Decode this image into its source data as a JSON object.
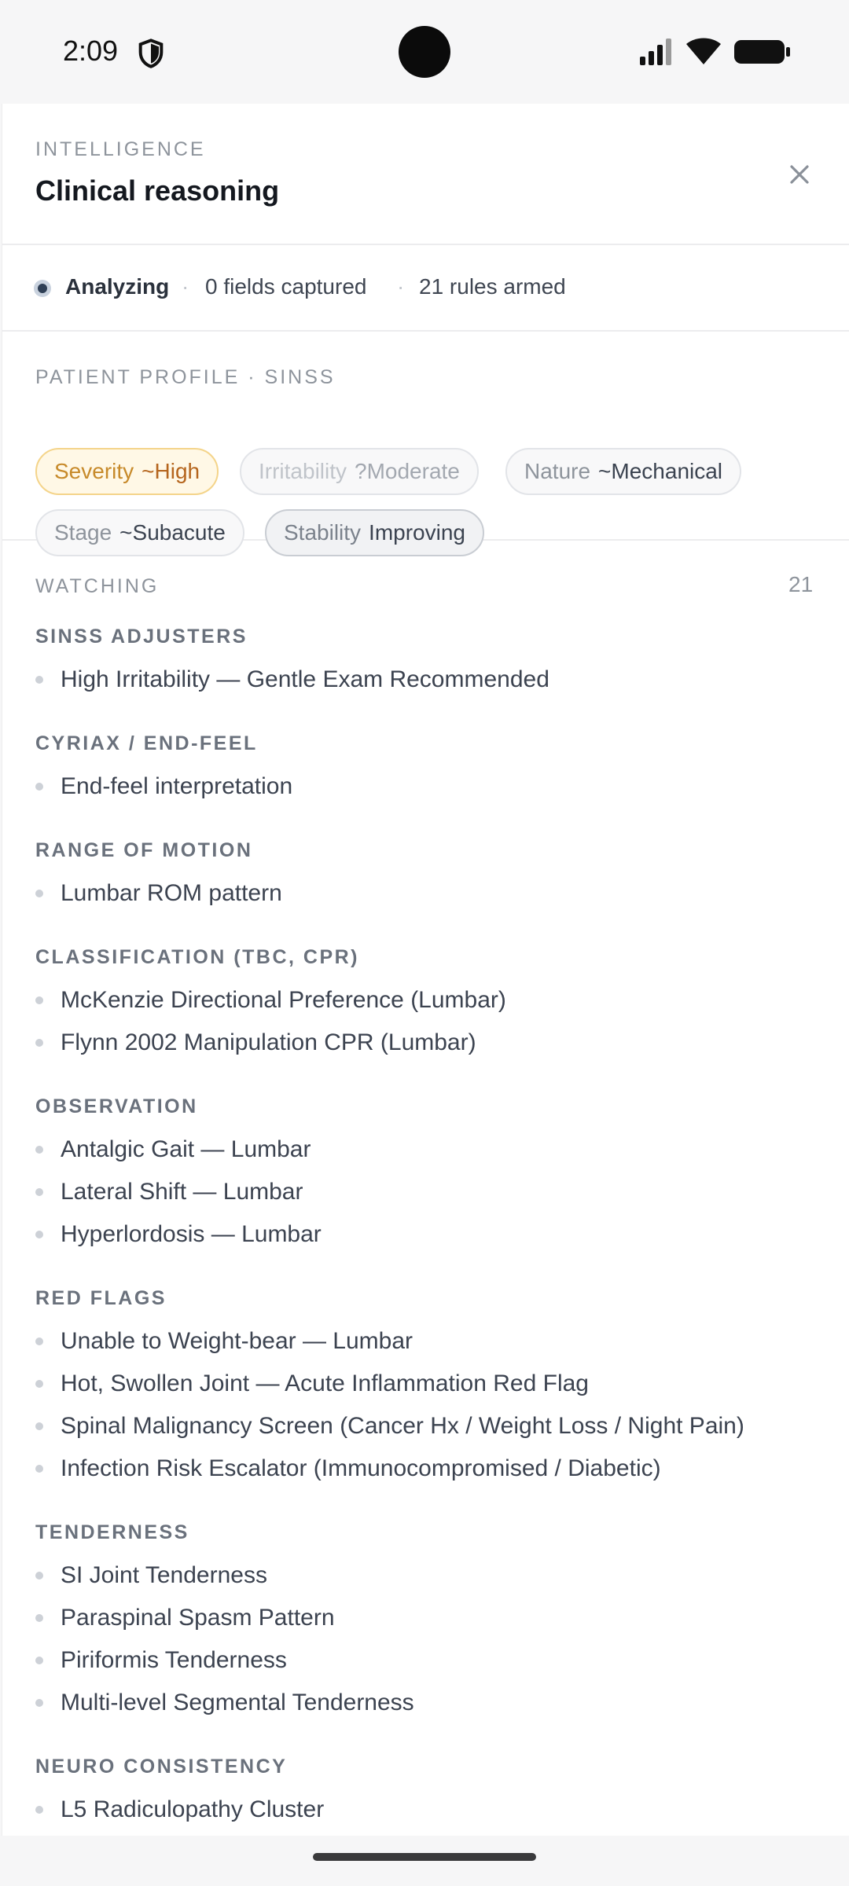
{
  "status_bar": {
    "time": "2:09",
    "icons": [
      "shield-icon",
      "signal-icon",
      "wifi-icon",
      "battery-icon"
    ]
  },
  "header": {
    "eyebrow": "INTELLIGENCE",
    "title": "Clinical reasoning",
    "close_icon": "×"
  },
  "status": {
    "state": "Analyzing",
    "sep": "·",
    "fields": "0 fields captured",
    "rules": "21 rules armed"
  },
  "profile": {
    "label": "PATIENT PROFILE · SINSS",
    "chips": [
      {
        "key": "Severity",
        "value": "~High"
      },
      {
        "key": "Irritability",
        "value": "?Moderate"
      },
      {
        "key": "Nature",
        "value": "~Mechanical"
      },
      {
        "key": "Stage",
        "value": "~Subacute"
      },
      {
        "key": "Stability",
        "value": "Improving"
      }
    ]
  },
  "watching": {
    "label": "WATCHING",
    "count": "21",
    "groups": [
      {
        "title": "SINSS ADJUSTERS",
        "items": [
          "High Irritability — Gentle Exam Recommended"
        ]
      },
      {
        "title": "CYRIAX / END-FEEL",
        "items": [
          "End-feel interpretation"
        ]
      },
      {
        "title": "RANGE OF MOTION",
        "items": [
          "Lumbar ROM pattern"
        ]
      },
      {
        "title": "CLASSIFICATION (TBC, CPR)",
        "items": [
          "McKenzie Directional Preference (Lumbar)",
          "Flynn 2002 Manipulation CPR (Lumbar)"
        ]
      },
      {
        "title": "OBSERVATION",
        "items": [
          "Antalgic Gait — Lumbar",
          "Lateral Shift — Lumbar",
          "Hyperlordosis — Lumbar"
        ]
      },
      {
        "title": "RED FLAGS",
        "items": [
          "Unable to Weight-bear — Lumbar",
          "Hot, Swollen Joint — Acute Inflammation Red Flag",
          "Spinal Malignancy Screen (Cancer Hx / Weight Loss / Night Pain)",
          "Infection Risk Escalator (Immunocompromised / Diabetic)"
        ]
      },
      {
        "title": "TENDERNESS",
        "items": [
          "SI Joint Tenderness",
          "Paraspinal Spasm Pattern",
          "Piriformis Tenderness",
          "Multi-level Segmental Tenderness"
        ]
      },
      {
        "title": "NEURO CONSISTENCY",
        "items": [
          "L5 Radiculopathy Cluster"
        ]
      }
    ]
  },
  "colors": {
    "accent_dark": "#2f3f55",
    "severity_bg": "#fff8e6",
    "severity_text": "#b5651d"
  }
}
